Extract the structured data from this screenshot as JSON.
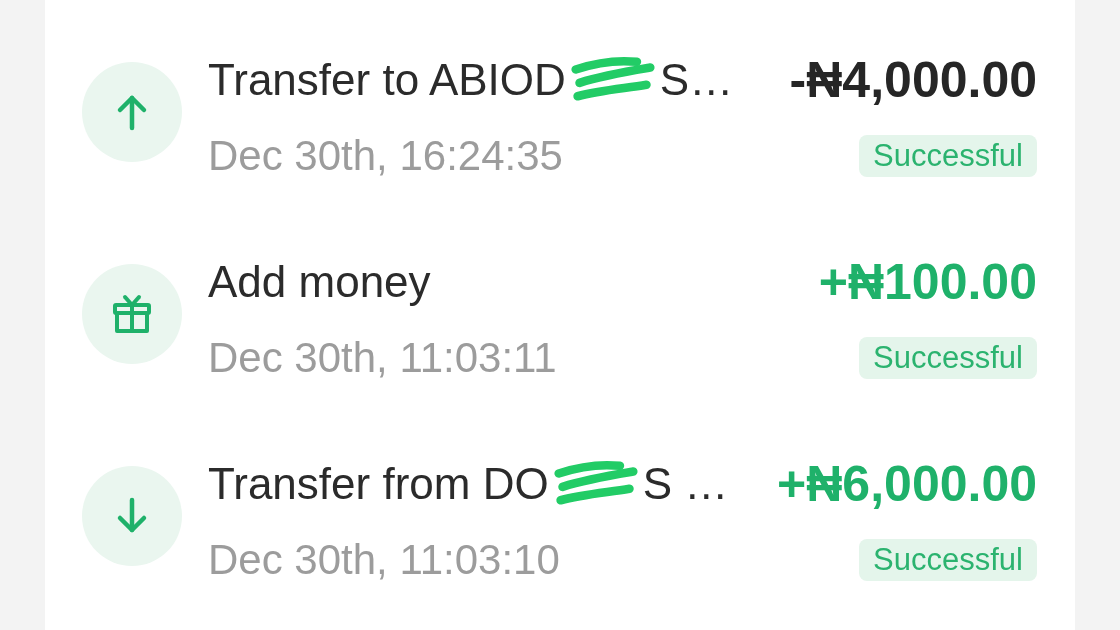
{
  "transactions": [
    {
      "kind": "transfer_out",
      "title": "Transfer to ABIOD",
      "redacted": true,
      "title_end": "S…",
      "amount": "-₦4,000.00",
      "date": "Dec 30th, 16:24:35",
      "status": "Successful"
    },
    {
      "kind": "deposit",
      "title": "Add money",
      "redacted": false,
      "amount": "+₦100.00",
      "date": "Dec 30th, 11:03:11",
      "status": "Successful"
    },
    {
      "kind": "transfer_in",
      "title": "Transfer from DO",
      "redacted": true,
      "title_end": "S …",
      "amount": "+₦6,000.00",
      "date": "Dec 30th, 11:03:10",
      "status": "Successful"
    }
  ]
}
